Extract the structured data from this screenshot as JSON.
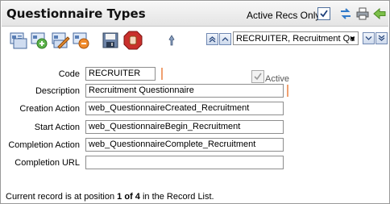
{
  "window": {
    "title": "Questionnaire Types",
    "active_recs_label": "Active Recs Only",
    "active_recs_checked": true
  },
  "toolbar": {
    "icons": [
      "new-record-icon",
      "add-record-icon",
      "edit-record-icon",
      "delete-record-icon",
      "save-icon",
      "stop-icon",
      "pin-icon"
    ],
    "record_selector_value": "RECRUITER, Recruitment Qu"
  },
  "form": {
    "code_label": "Code",
    "code_value": "RECRUITER",
    "active_label": "Active",
    "active_checked": true,
    "description_label": "Description",
    "description_value": "Recruitment Questionnaire",
    "creation_action_label": "Creation Action",
    "creation_action_value": "web_QuestionnaireCreated_Recruitment",
    "start_action_label": "Start Action",
    "start_action_value": "web_QuestionnaireBegin_Recruitment",
    "completion_action_label": "Completion Action",
    "completion_action_value": "web_QuestionnaireComplete_Recruitment",
    "completion_url_label": "Completion URL",
    "completion_url_value": ""
  },
  "status": {
    "prefix": "Current record is at position ",
    "position": "1 of 4",
    "suffix": " in the Record List."
  },
  "colors": {
    "required_marker": "#f0a070",
    "accent_blue": "#3a5f9e"
  }
}
